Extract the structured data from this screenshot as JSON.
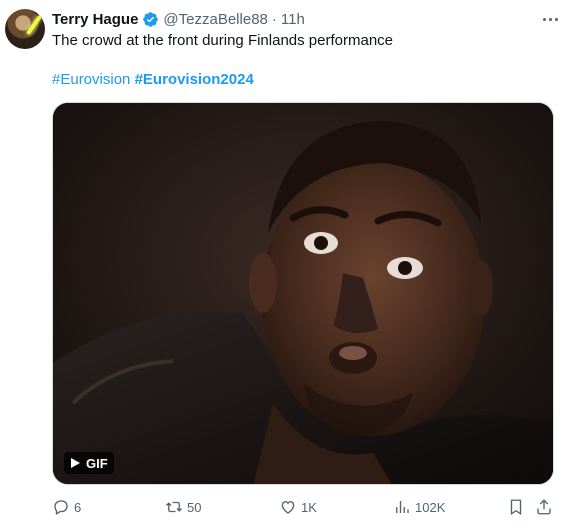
{
  "author": {
    "name": "Terry Hague",
    "handle": "@TezzaBelle88",
    "separator": "·",
    "time": "11h",
    "verified_icon": "verified-badge-icon",
    "verified_color": "#1d9bf0"
  },
  "tweet": {
    "text": "The crowd at the front during Finlands performance",
    "hashtags": [
      "#Eurovision",
      "#Eurovision2024"
    ]
  },
  "media": {
    "badge_label": "GIF"
  },
  "actions": {
    "replies": "6",
    "retweets": "50",
    "likes": "1K",
    "views": "102K"
  },
  "colors": {
    "link": "#1d9bf0",
    "muted": "#536471",
    "text": "#0f1419"
  }
}
